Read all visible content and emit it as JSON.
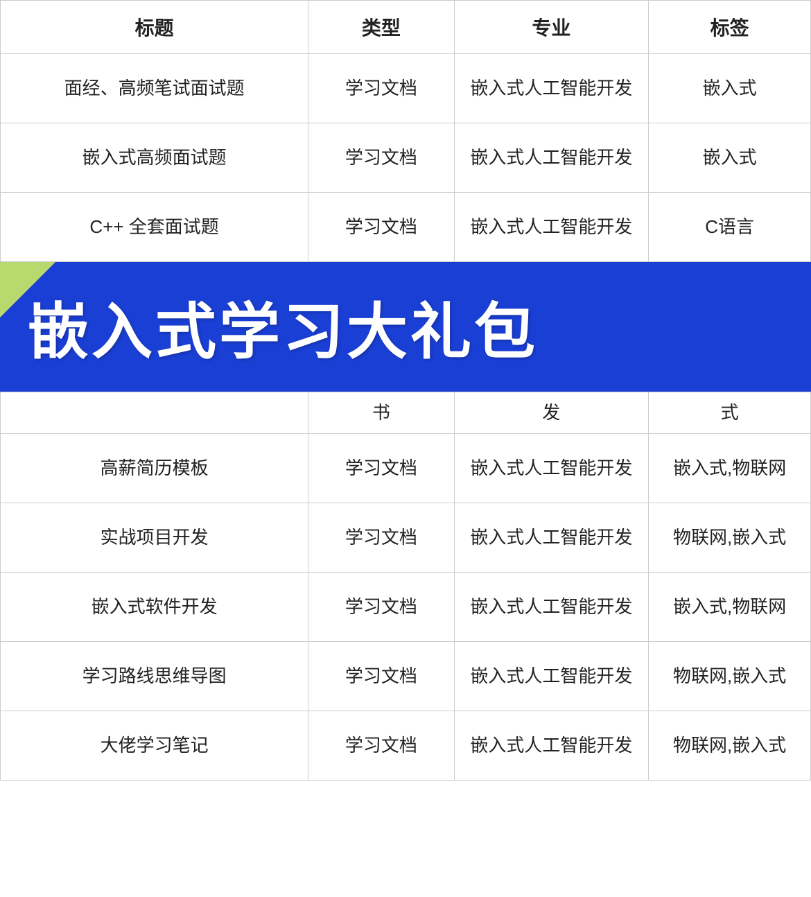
{
  "header": {
    "col1": "标题",
    "col2": "类型",
    "col3": "专业",
    "col4": "标签"
  },
  "banner": {
    "text": "嵌入式学习大礼包"
  },
  "rows_above_banner": [
    {
      "title": "面经、高频笔试面试题",
      "type": "学习文档",
      "major": "嵌入式人工智能开发",
      "tag": "嵌入式"
    },
    {
      "title": "嵌入式高频面试题",
      "type": "学习文档",
      "major": "嵌入式人工智能开发",
      "tag": "嵌入式"
    },
    {
      "title": "C++ 全套面试题",
      "type": "学习文档",
      "major": "嵌入式人工智能开发",
      "tag": "C语言"
    }
  ],
  "partial_above": {
    "col1": "",
    "col2": "书",
    "col3": "发",
    "col4": "式"
  },
  "rows_below_banner": [
    {
      "title": "高薪简历模板",
      "type": "学习文档",
      "major": "嵌入式人工智能开发",
      "tag": "嵌入式,物联网"
    },
    {
      "title": "实战项目开发",
      "type": "学习文档",
      "major": "嵌入式人工智能开发",
      "tag": "物联网,嵌入式"
    },
    {
      "title": "嵌入式软件开发",
      "type": "学习文档",
      "major": "嵌入式人工智能开发",
      "tag": "嵌入式,物联网"
    },
    {
      "title": "学习路线思维导图",
      "type": "学习文档",
      "major": "嵌入式人工智能开发",
      "tag": "物联网,嵌入式"
    },
    {
      "title": "大佬学习笔记",
      "type": "学习文档",
      "major": "嵌入式人工智能开发",
      "tag": "物联网,嵌入式"
    }
  ]
}
